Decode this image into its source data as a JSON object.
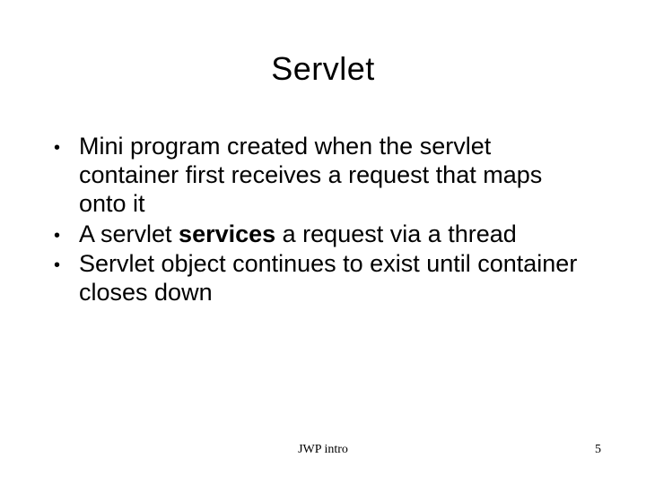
{
  "title": "Servlet",
  "bullets": [
    {
      "pre": "Mini program created when the servlet container first receives a request that maps onto it",
      "bold": "",
      "post": ""
    },
    {
      "pre": "A servlet ",
      "bold": "services",
      "post": " a request via a thread"
    },
    {
      "pre": "Servlet object continues to exist until container closes down",
      "bold": "",
      "post": ""
    }
  ],
  "footer": {
    "center": "JWP intro",
    "page": "5"
  }
}
